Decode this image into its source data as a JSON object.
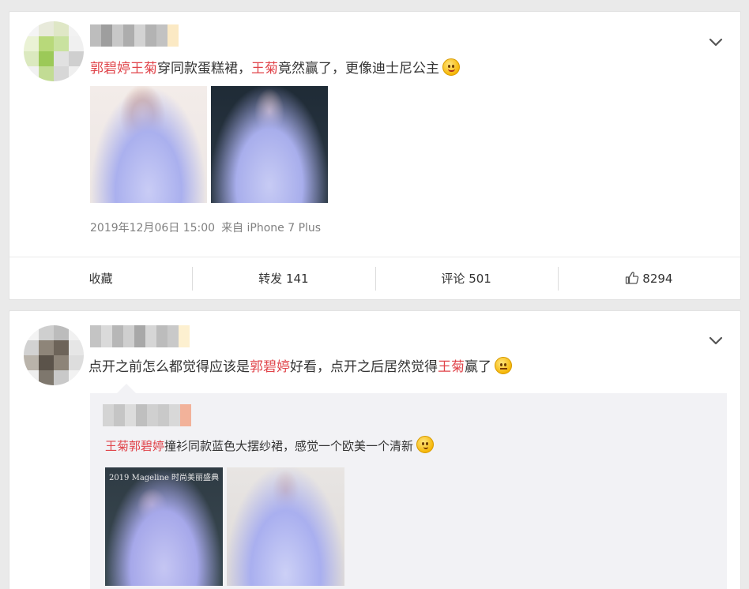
{
  "posts": [
    {
      "text_parts": [
        {
          "text": "郭碧婷王菊",
          "mention": true
        },
        {
          "text": "穿同款蛋糕裙，",
          "mention": false
        },
        {
          "text": "王菊",
          "mention": true
        },
        {
          "text": "竟然赢了，更像迪士尼公主",
          "mention": false
        }
      ],
      "emoji": "yummy-emoji",
      "timestamp": "2019年12月06日 15:00",
      "source": "来自 iPhone 7 Plus",
      "actions": {
        "favorite": "收藏",
        "repost": "转发 141",
        "comment": "评论 501",
        "like": "8294"
      }
    },
    {
      "text_parts": [
        {
          "text": "点开之前怎么都觉得应该是",
          "mention": false
        },
        {
          "text": "郭碧婷",
          "mention": true
        },
        {
          "text": "好看，点开之后居然觉得",
          "mention": false
        },
        {
          "text": "王菊",
          "mention": true
        },
        {
          "text": "赢了",
          "mention": false
        }
      ],
      "emoji": "confused-emoji",
      "repost": {
        "text_parts": [
          {
            "text": "王菊郭碧婷",
            "mention": true
          },
          {
            "text": "撞衫同款蓝色大摆纱裙，感觉一个欧美一个清新",
            "mention": false
          }
        ],
        "emoji": "thinking-emoji",
        "image_captions": [
          "2019 Mageline 时尚美丽盛典",
          ""
        ]
      }
    }
  ],
  "colors": {
    "mention": "#eb7350",
    "page_bg": "#eaeaea",
    "repost_bg": "#f2f2f5"
  }
}
